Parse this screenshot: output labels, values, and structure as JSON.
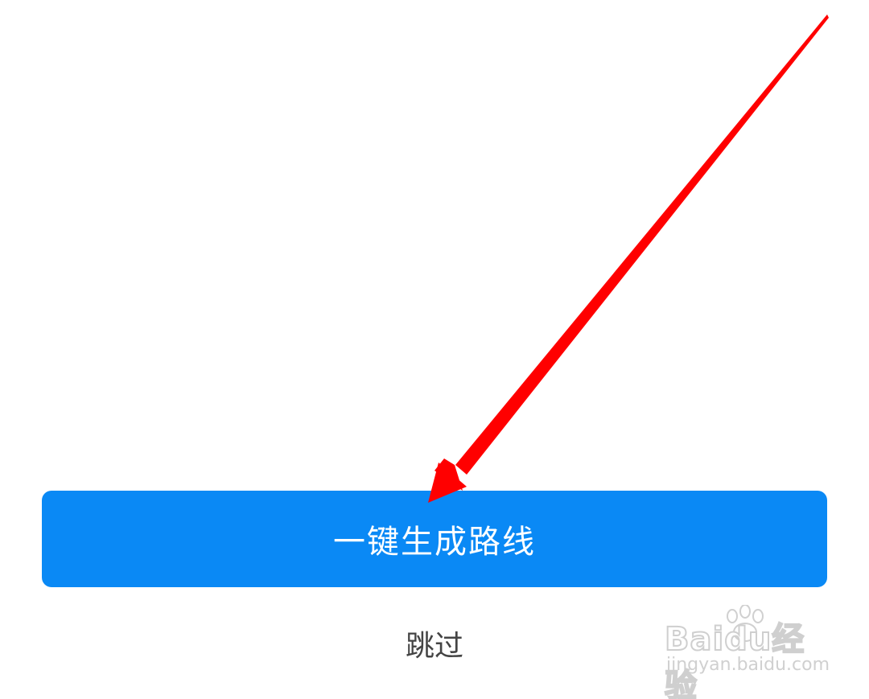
{
  "actions": {
    "primary_label": "一键生成路线",
    "skip_label": "跳过"
  },
  "annotation": {
    "arrow_color": "#ff0000",
    "arrow_icon": "red-arrow-annotation-icon"
  },
  "watermark": {
    "brand": "Baidu经验",
    "url": "jingyan.baidu.com"
  },
  "colors": {
    "button_bg": "#0a89f5",
    "button_text": "#ffffff",
    "skip_text": "#444444"
  }
}
